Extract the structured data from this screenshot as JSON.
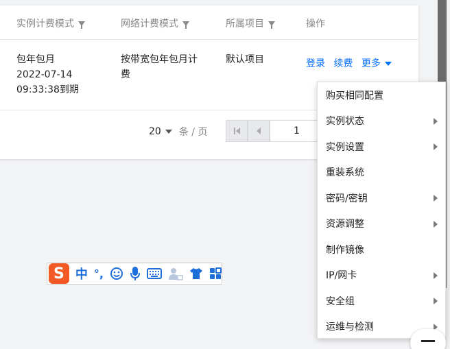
{
  "table": {
    "columns": [
      {
        "label": "实例计费模式",
        "filterable": true
      },
      {
        "label": "网络计费模式",
        "filterable": true
      },
      {
        "label": "所属项目",
        "filterable": true
      },
      {
        "label": "操作",
        "filterable": false
      }
    ],
    "row": {
      "billing_mode": "包年包月",
      "expiry_date": "2022-07-14",
      "expiry_time": "09:33:38到期",
      "network_billing_line1": "按带宽包年包月计",
      "network_billing_line2": "费",
      "project": "默认项目",
      "actions": {
        "login": "登录",
        "renew": "续费",
        "more": "更多"
      }
    }
  },
  "pagination": {
    "page_size": "20",
    "unit": "条 / 页",
    "current_page": "1"
  },
  "more_menu": {
    "items": [
      {
        "label": "购买相同配置",
        "submenu": false
      },
      {
        "label": "实例状态",
        "submenu": true
      },
      {
        "label": "实例设置",
        "submenu": true
      },
      {
        "label": "重装系统",
        "submenu": false
      },
      {
        "label": "密码/密钥",
        "submenu": true
      },
      {
        "label": "资源调整",
        "submenu": true
      },
      {
        "label": "制作镜像",
        "submenu": false
      },
      {
        "label": "IP/网卡",
        "submenu": true
      },
      {
        "label": "安全组",
        "submenu": true
      },
      {
        "label": "运维与检测",
        "submenu": true
      }
    ]
  },
  "ime_toolbar": {
    "logo": "S",
    "mode": "中",
    "punct": "°,",
    "icons": [
      "emoji-icon",
      "microphone-icon",
      "keyboard-icon",
      "user-tools-icon",
      "skin-shirt-icon",
      "grid-apps-icon"
    ]
  },
  "colors": {
    "link": "#006eff",
    "ime_logo": "#f15a24",
    "ime_icon": "#1e6fd9"
  }
}
